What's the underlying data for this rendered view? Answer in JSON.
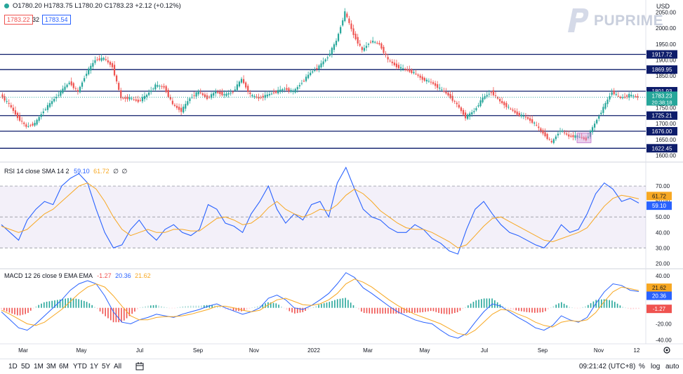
{
  "header": {
    "ohlc": "O1780.20 H1783.75 L1780.20 C1783.23 +2.12 (+0.12%)",
    "bid": "1783.22",
    "spread": "32",
    "ask": "1783.54",
    "currency": "USD"
  },
  "logo": {
    "text": "PUPRIME"
  },
  "toolbar": {
    "ranges": [
      "1D",
      "5D",
      "1M",
      "3M",
      "6M",
      "YTD",
      "1Y",
      "5Y",
      "All"
    ],
    "time": "09:21:42 (UTC+8)",
    "percent": "%",
    "log": "log",
    "auto": "auto"
  },
  "chart_data": [
    {
      "type": "candlestick",
      "symbol": "XAUUSD",
      "price_axis": [
        "2050.00",
        "2000.00",
        "1950.00",
        "1900.00",
        "1850.00",
        "1800.00",
        "1750.00",
        "1700.00",
        "1650.00",
        "1600.00"
      ],
      "ylim": [
        1590,
        2080
      ],
      "x_labels": [
        "Mar",
        "May",
        "Jul",
        "Sep",
        "Nov",
        "2022",
        "Mar",
        "May",
        "Jul",
        "Sep",
        "Nov",
        "12"
      ],
      "horizontal_levels": [
        {
          "label": "1917.72",
          "value": 1917.72
        },
        {
          "label": "1869.95",
          "value": 1869.95
        },
        {
          "label": "1801.93",
          "value": 1801.93
        },
        {
          "label": "1725.21",
          "value": 1725.21
        },
        {
          "label": "1676.00",
          "value": 1676.0
        },
        {
          "label": "1622.45",
          "value": 1622.45
        }
      ],
      "last_price": {
        "label": "1783.23",
        "countdown": "20:38:18",
        "value": 1783.23
      },
      "close_path": [
        1790,
        1760,
        1720,
        1690,
        1700,
        1740,
        1770,
        1800,
        1830,
        1800,
        1860,
        1900,
        1905,
        1880,
        1780,
        1780,
        1770,
        1790,
        1820,
        1815,
        1760,
        1740,
        1780,
        1800,
        1780,
        1800,
        1790,
        1800,
        1840,
        1790,
        1780,
        1790,
        1800,
        1810,
        1800,
        1830,
        1860,
        1880,
        1910,
        1960,
        2050,
        1980,
        1930,
        1960,
        1950,
        1900,
        1880,
        1870,
        1860,
        1840,
        1830,
        1810,
        1790,
        1760,
        1720,
        1740,
        1780,
        1800,
        1770,
        1750,
        1730,
        1720,
        1700,
        1670,
        1640,
        1680,
        1660,
        1660,
        1650,
        1700,
        1750,
        1800,
        1780,
        1790,
        1783
      ]
    },
    {
      "type": "line",
      "title": "RSI 14 close SMA 14 2",
      "values_text": [
        "59.10",
        "61.72",
        "∅",
        "∅"
      ],
      "y_axis": [
        "70.00",
        "60.00",
        "50.00",
        "40.00",
        "30.00",
        "20.00"
      ],
      "bands": [
        70,
        50,
        30
      ],
      "ylim": [
        17,
        85
      ],
      "series": [
        {
          "name": "RSI",
          "color": "#2962ff",
          "last": 59.1,
          "values": [
            45,
            40,
            35,
            48,
            55,
            60,
            58,
            70,
            75,
            78,
            72,
            55,
            40,
            30,
            32,
            42,
            48,
            40,
            35,
            42,
            45,
            40,
            38,
            42,
            58,
            55,
            46,
            44,
            40,
            52,
            60,
            70,
            55,
            46,
            52,
            48,
            58,
            60,
            50,
            72,
            82,
            68,
            55,
            50,
            48,
            43,
            40,
            40,
            45,
            42,
            36,
            33,
            28,
            26,
            42,
            55,
            60,
            52,
            45,
            40,
            38,
            35,
            32,
            30,
            36,
            45,
            40,
            42,
            52,
            65,
            72,
            68,
            60,
            62,
            59
          ]
        },
        {
          "name": "RSI-based MA",
          "color": "#f7a823",
          "last": 61.72,
          "values": [
            44,
            42,
            40,
            42,
            47,
            52,
            55,
            60,
            65,
            70,
            72,
            68,
            60,
            50,
            42,
            38,
            40,
            42,
            40,
            40,
            42,
            42,
            41,
            41,
            45,
            49,
            50,
            48,
            45,
            46,
            50,
            56,
            60,
            55,
            52,
            50,
            52,
            55,
            54,
            58,
            64,
            68,
            65,
            60,
            54,
            50,
            46,
            43,
            42,
            42,
            40,
            37,
            34,
            30,
            32,
            38,
            44,
            49,
            50,
            47,
            44,
            41,
            38,
            35,
            34,
            36,
            38,
            40,
            43,
            50,
            57,
            62,
            64,
            63,
            61.72
          ]
        }
      ]
    },
    {
      "type": "line",
      "title": "MACD 12 26 close 9 EMA EMA",
      "values_text": [
        "-1.27",
        "20.36",
        "21.62"
      ],
      "y_axis": [
        "40.00",
        "20.00",
        "0.00",
        "-20.00",
        "-40.00"
      ],
      "ylim": [
        -45,
        48
      ],
      "series": [
        {
          "name": "MACD",
          "color": "#2962ff",
          "last": 20.36,
          "values": [
            -5,
            -15,
            -25,
            -28,
            -20,
            -10,
            0,
            10,
            22,
            30,
            34,
            30,
            15,
            -5,
            -18,
            -20,
            -15,
            -12,
            -8,
            -10,
            -12,
            -8,
            -5,
            -2,
            2,
            5,
            0,
            -4,
            -8,
            -5,
            0,
            12,
            16,
            10,
            0,
            -2,
            3,
            10,
            18,
            30,
            44,
            38,
            25,
            18,
            10,
            2,
            -5,
            -10,
            -15,
            -18,
            -20,
            -28,
            -35,
            -38,
            -32,
            -18,
            -5,
            5,
            2,
            -5,
            -12,
            -18,
            -25,
            -28,
            -22,
            -10,
            -15,
            -18,
            -12,
            5,
            20,
            30,
            28,
            22,
            20.36
          ]
        },
        {
          "name": "Signal",
          "color": "#f7a823",
          "last": 21.62,
          "values": [
            -3,
            -8,
            -14,
            -20,
            -22,
            -18,
            -10,
            -2,
            8,
            18,
            26,
            30,
            26,
            15,
            2,
            -10,
            -15,
            -15,
            -12,
            -11,
            -11,
            -10,
            -8,
            -5,
            -2,
            2,
            2,
            0,
            -3,
            -5,
            -3,
            4,
            10,
            12,
            8,
            4,
            3,
            5,
            10,
            18,
            30,
            36,
            32,
            26,
            18,
            10,
            3,
            -3,
            -8,
            -12,
            -16,
            -20,
            -26,
            -32,
            -34,
            -28,
            -18,
            -8,
            -2,
            -3,
            -8,
            -12,
            -18,
            -22,
            -24,
            -18,
            -16,
            -17,
            -15,
            -6,
            8,
            20,
            26,
            24,
            21.62
          ]
        }
      ],
      "histogram_last": -1.27
    }
  ]
}
